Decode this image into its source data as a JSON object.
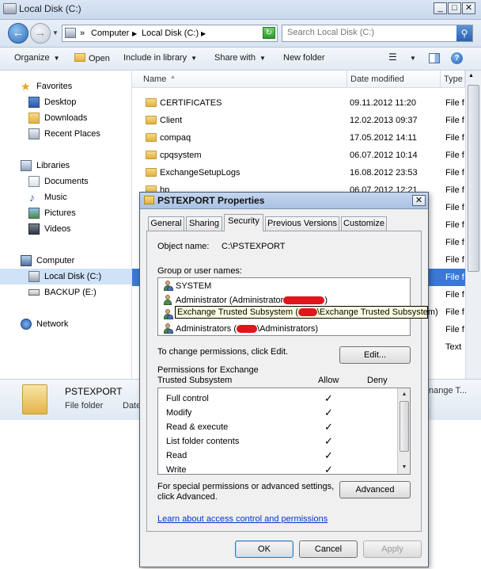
{
  "window": {
    "title": "Local Disk (C:)"
  },
  "address": {
    "crumbs": [
      "Computer",
      "Local Disk (C:)"
    ],
    "chevron": "»"
  },
  "search": {
    "placeholder": "Search Local Disk (C:)"
  },
  "toolbar": {
    "organize": "Organize",
    "open": "Open",
    "include": "Include in library",
    "share": "Share with",
    "new_folder": "New folder"
  },
  "nav": {
    "favorites": "Favorites",
    "desktop": "Desktop",
    "downloads": "Downloads",
    "recent": "Recent Places",
    "libraries": "Libraries",
    "documents": "Documents",
    "music": "Music",
    "pictures": "Pictures",
    "videos": "Videos",
    "computer": "Computer",
    "local_disk": "Local Disk (C:)",
    "backup": "BACKUP (E:)",
    "network": "Network"
  },
  "columns": {
    "name": "Name",
    "date": "Date modified",
    "type": "Type"
  },
  "files": [
    {
      "name": "CERTIFICATES",
      "date": "09.11.2012 11:20",
      "type": "File f"
    },
    {
      "name": "Client",
      "date": "12.02.2013 09:37",
      "type": "File f"
    },
    {
      "name": "compaq",
      "date": "17.05.2012 14:11",
      "type": "File f"
    },
    {
      "name": "cpqsystem",
      "date": "06.07.2012 10:14",
      "type": "File f"
    },
    {
      "name": "ExchangeSetupLogs",
      "date": "16.08.2012 23:53",
      "type": "File f"
    },
    {
      "name": "hp",
      "date": "06.07.2012 12:21",
      "type": "File f"
    }
  ],
  "hidden_types": [
    "File f",
    "File f",
    "File f",
    "File f",
    "File f",
    "File f",
    "File f",
    "File f",
    "Text"
  ],
  "details": {
    "name": "PSTEXPORT",
    "type": "File folder",
    "date_label": "Date",
    "right_text": "nange T..."
  },
  "dialog": {
    "title": "PSTEXPORT Properties",
    "tabs": [
      "General",
      "Sharing",
      "Security",
      "Previous Versions",
      "Customize"
    ],
    "active_tab": "Security",
    "object_label": "Object name:",
    "object_value": "C:\\PSTEXPORT",
    "group_label": "Group or user names:",
    "users": {
      "system": "SYSTEM",
      "admin_a": "Administrator (Administrator",
      "admin_b": ")",
      "exch_a": "Exchange Trusted Subsystem (",
      "exch_b": "\\Exchange Trusted Subsystem)",
      "admins_a": "Administrators (",
      "admins_b": "\\Administrators)"
    },
    "change_hint": "To change permissions, click Edit.",
    "edit_button": "Edit...",
    "perm_label_1": "Permissions for Exchange",
    "perm_label_2": "Trusted Subsystem",
    "allow": "Allow",
    "deny": "Deny",
    "permissions": [
      {
        "name": "Full control",
        "allow": "✓"
      },
      {
        "name": "Modify",
        "allow": "✓"
      },
      {
        "name": "Read & execute",
        "allow": "✓"
      },
      {
        "name": "List folder contents",
        "allow": "✓"
      },
      {
        "name": "Read",
        "allow": "✓"
      },
      {
        "name": "Write",
        "allow": "✓"
      }
    ],
    "special_1": "For special permissions or advanced settings,",
    "special_2": "click Advanced.",
    "advanced_button": "Advanced",
    "learn_link": "Learn about access control and permissions",
    "ok": "OK",
    "cancel": "Cancel",
    "apply": "Apply"
  },
  "colors": {
    "selection": "#3a78d4",
    "redaction": "#e0161c",
    "link": "#0033cc"
  }
}
